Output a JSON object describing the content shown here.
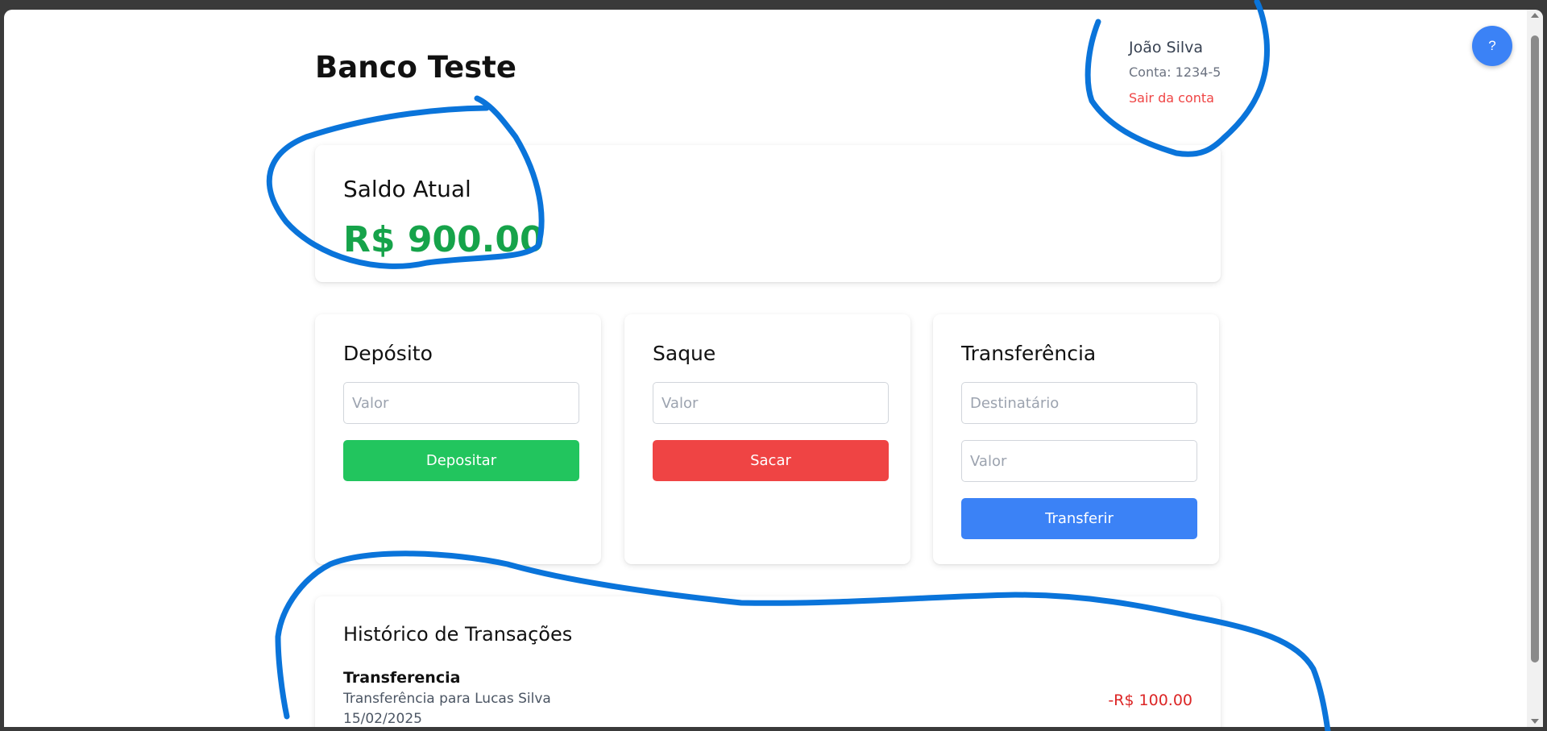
{
  "app": {
    "title": "Banco Teste"
  },
  "user": {
    "name": "João Silva",
    "account": "Conta: 1234-5",
    "logout_label": "Sair da conta"
  },
  "help": {
    "label": "?"
  },
  "balance": {
    "title": "Saldo Atual",
    "value": "R$ 900.00"
  },
  "deposit": {
    "title": "Depósito",
    "amount_placeholder": "Valor",
    "button_label": "Depositar"
  },
  "withdraw": {
    "title": "Saque",
    "amount_placeholder": "Valor",
    "button_label": "Sacar"
  },
  "transfer": {
    "title": "Transferência",
    "recipient_placeholder": "Destinatário",
    "amount_placeholder": "Valor",
    "button_label": "Transferir"
  },
  "history": {
    "title": "Histórico de Transações",
    "transactions": [
      {
        "type": "Transferencia",
        "description": "Transferência para Lucas Silva",
        "date": "15/02/2025",
        "amount": "-R$ 100.00"
      }
    ]
  },
  "colors": {
    "accent": "#3b82f6",
    "balance": "#16a34a",
    "deposit": "#22c55e",
    "withdraw": "#ef4444",
    "debit": "#dc2626",
    "annotation": "#0a74da"
  }
}
